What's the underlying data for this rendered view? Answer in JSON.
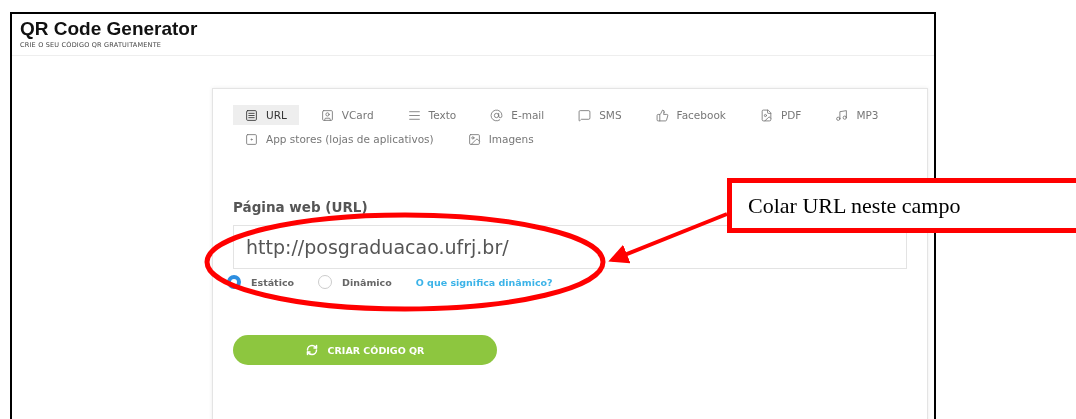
{
  "header": {
    "title": "QR Code Generator",
    "subtitle": "CRIE O SEU CÓDIGO QR GRATUITAMENTE"
  },
  "tabs": [
    {
      "label": "URL",
      "selected": true
    },
    {
      "label": "VCard",
      "selected": false
    },
    {
      "label": "Texto",
      "selected": false
    },
    {
      "label": "E-mail",
      "selected": false
    },
    {
      "label": "SMS",
      "selected": false
    },
    {
      "label": "Facebook",
      "selected": false
    },
    {
      "label": "PDF",
      "selected": false
    },
    {
      "label": "MP3",
      "selected": false
    },
    {
      "label": "App stores (lojas de aplicativos)",
      "selected": false
    },
    {
      "label": "Imagens",
      "selected": false
    }
  ],
  "field": {
    "label": "Página web (URL)",
    "value": "http://posgraduacao.ufrj.br/"
  },
  "radios": [
    {
      "label": "Estático",
      "selected": true
    },
    {
      "label": "Dinâmico",
      "selected": false
    }
  ],
  "help_link": "O que significa dinâmico?",
  "button": "CRIAR CÓDIGO QR",
  "annotation": {
    "callout": "Colar URL neste campo"
  }
}
